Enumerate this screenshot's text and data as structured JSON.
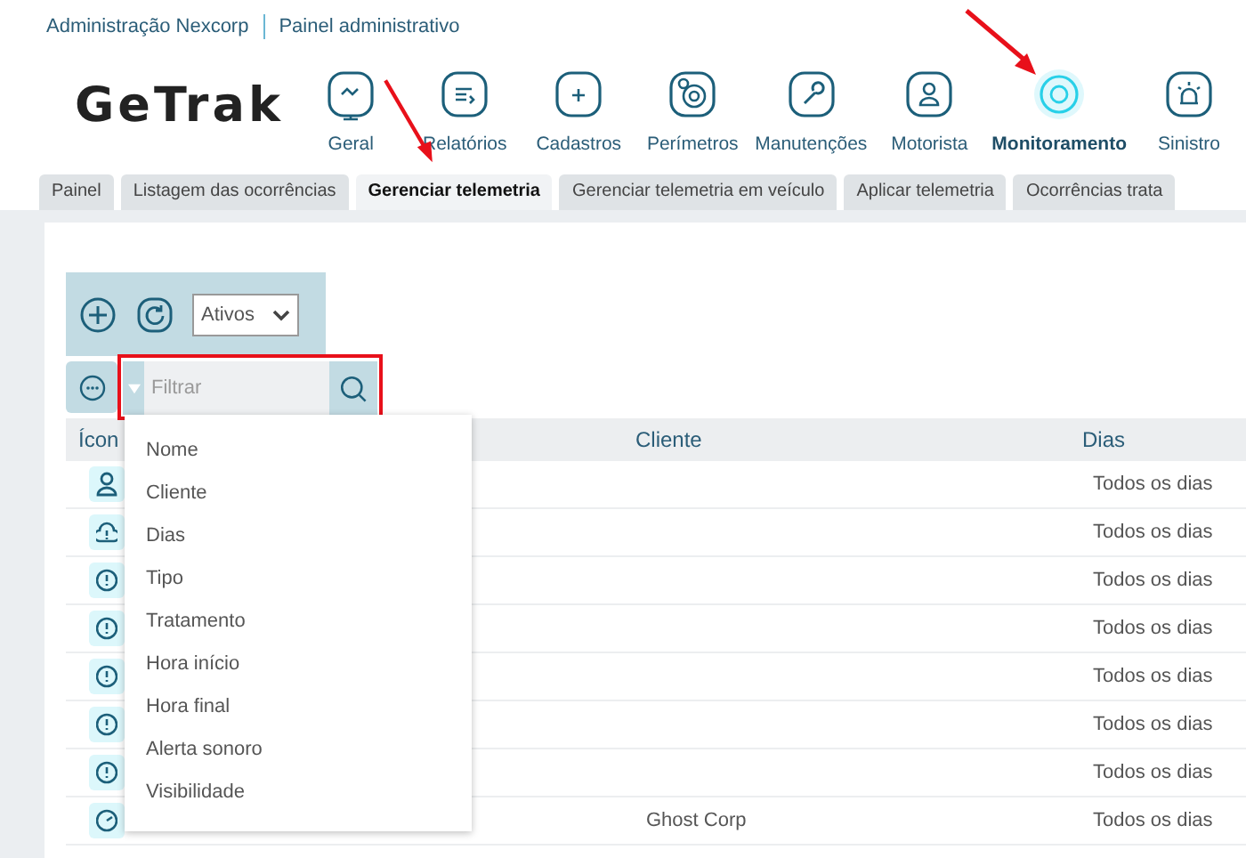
{
  "breadcrumb": {
    "company": "Administração Nexcorp",
    "section": "Painel administrativo"
  },
  "logo": {
    "text": "GeTrak"
  },
  "nav": [
    {
      "label": "Geral",
      "kind": "monitor",
      "selected": false
    },
    {
      "label": "Relatórios",
      "kind": "report",
      "selected": false
    },
    {
      "label": "Cadastros",
      "kind": "folder",
      "selected": false
    },
    {
      "label": "Perímetros",
      "kind": "target",
      "selected": false
    },
    {
      "label": "Manutenções",
      "kind": "wrench",
      "selected": false
    },
    {
      "label": "Motorista",
      "kind": "person",
      "selected": false
    },
    {
      "label": "Monitoramento",
      "kind": "circle",
      "selected": true
    },
    {
      "label": "Sinistro",
      "kind": "siren",
      "selected": false
    }
  ],
  "tabs": [
    {
      "label": "Painel",
      "selected": false
    },
    {
      "label": "Listagem das ocorrências",
      "selected": false
    },
    {
      "label": "Gerenciar telemetria",
      "selected": true
    },
    {
      "label": "Gerenciar telemetria em veículo",
      "selected": false
    },
    {
      "label": "Aplicar telemetria",
      "selected": false
    },
    {
      "label": "Ocorrências trata",
      "selected": false
    }
  ],
  "toolbar": {
    "status_select": "Ativos"
  },
  "filter": {
    "placeholder": "Filtrar",
    "options": [
      "Nome",
      "Cliente",
      "Dias",
      "Tipo",
      "Tratamento",
      "Hora início",
      "Hora final",
      "Alerta sonoro",
      "Visibilidade"
    ]
  },
  "table": {
    "columns": [
      "Ícon",
      "Cliente",
      "Dias"
    ],
    "rows": [
      {
        "kind": "person",
        "cliente": "",
        "dias": "Todos os dias"
      },
      {
        "kind": "cloud",
        "cliente": "",
        "dias": "Todos os dias"
      },
      {
        "kind": "alert",
        "cliente": "",
        "dias": "Todos os dias"
      },
      {
        "kind": "alert",
        "cliente": "",
        "dias": "Todos os dias"
      },
      {
        "kind": "alert",
        "cliente": "",
        "dias": "Todos os dias"
      },
      {
        "kind": "alert",
        "cliente": "",
        "dias": "Todos os dias"
      },
      {
        "kind": "alert",
        "cliente": "",
        "dias": "Todos os dias"
      },
      {
        "kind": "gauge",
        "cliente": "Ghost Corp",
        "dias": "Todos os dias"
      }
    ]
  }
}
